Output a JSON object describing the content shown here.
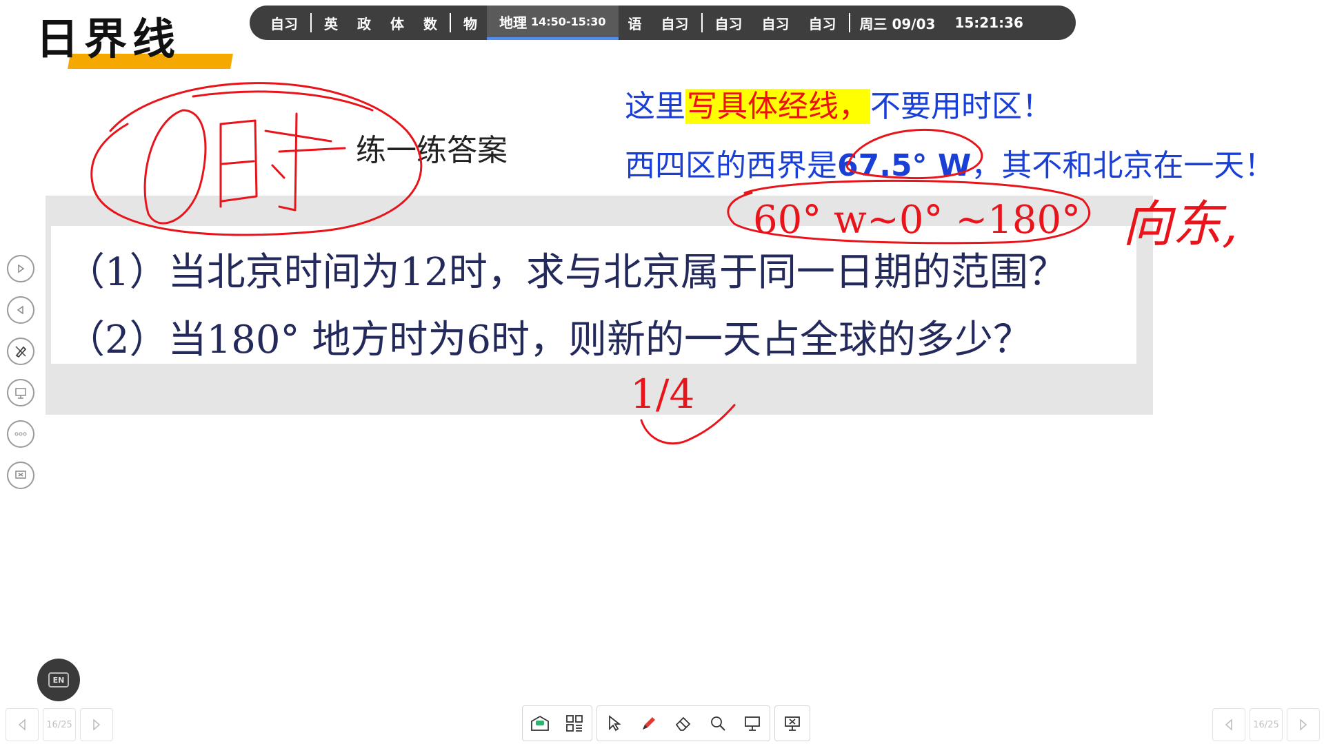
{
  "slide": {
    "title": "日界线",
    "practice_label": "练一练答案",
    "note1_before": "这里",
    "note1_highlight": "写具体经线，",
    "note1_after": "不要用时区！",
    "note2_before": "西四区的西界是",
    "note2_value": "67.5° W",
    "note2_after": "，其不和北京在一天！",
    "question1": "（1）当北京时间为12时，求与北京属于同一日期的范围？",
    "question2": "（2）当180° 地方时为6时，则新的一天占全球的多少？"
  },
  "handwriting": {
    "answer_range": "60° w~0° ~180°",
    "answer_direction": "向东,",
    "answer_fraction": "1/4",
    "zero_hour": "0时",
    "ink_color": "#e8141b"
  },
  "schedule": {
    "items_a": [
      "自习"
    ],
    "items_b": [
      "英",
      "政",
      "体",
      "数"
    ],
    "items_c": [
      "物"
    ],
    "current_subject": "地理",
    "current_time": "14:50-15:30",
    "items_d": [
      "语",
      "自习"
    ],
    "items_e": [
      "自习",
      "自习",
      "自习"
    ],
    "date": "周三 09/03",
    "clock": "15:21:36",
    "accent_color": "#4f8df5"
  },
  "pager": {
    "left_page": "16/25",
    "right_page": "16/25"
  },
  "left_toolbar": [
    "next-page-icon",
    "prev-page-icon",
    "pen-icon",
    "screen-share-icon",
    "more-icon",
    "close-screen-icon"
  ],
  "bottom_toolbar": [
    "whiteboard-icon",
    "apps-grid-icon",
    "pointer-icon",
    "pen-icon",
    "eraser-icon",
    "zoom-icon",
    "presentation-icon",
    "exit-presentation-icon"
  ],
  "en_button": "EN"
}
